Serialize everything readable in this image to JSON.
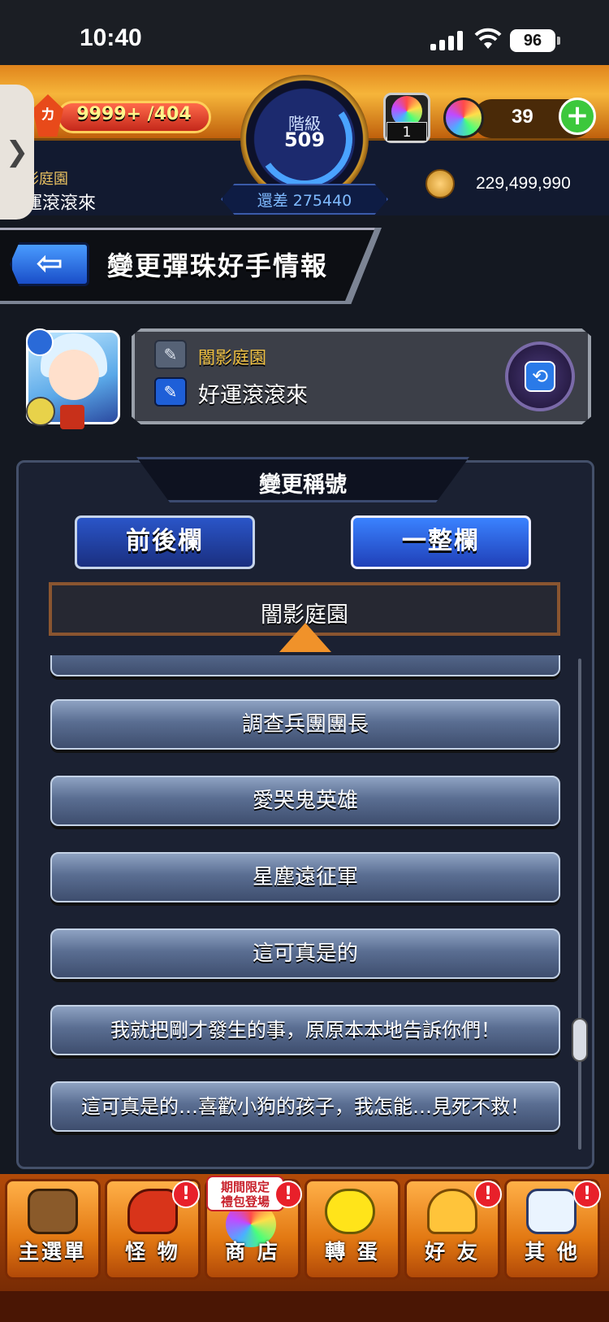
{
  "status_bar": {
    "time": "10:40",
    "battery": "96"
  },
  "header": {
    "stamina_icon": "カ",
    "stamina": "9999+ /404",
    "rank_label": "階級",
    "rank": "509",
    "remain": "還差 275440",
    "guild_line1": "影庭園",
    "guild_line2": "運滾滾來",
    "orb_stock_count": "1",
    "orb_count": "39",
    "gold": "229,499,990",
    "side_tab": "❯"
  },
  "title_bar": {
    "back_label": "⇦",
    "title": "變更彈珠好手情報"
  },
  "profile": {
    "guild_title": "闇影庭園",
    "nickname": "好運滾滾來",
    "pen_icon": "✎",
    "swap_icon": "⟲"
  },
  "panel": {
    "title": "變更稱號",
    "mode_left": "前後欄",
    "mode_right": "一整欄",
    "preview": "闇影庭園",
    "titles": [
      "調查兵團團長",
      "愛哭鬼英雄",
      "星塵遠征軍",
      "這可真是的",
      "我就把剛才發生的事，原原本本地告訴你們！",
      "這可真是的…喜歡小狗的孩子，我怎能…見死不救！"
    ]
  },
  "nav": {
    "items": [
      "主選單",
      "怪 物",
      "商 店",
      "轉 蛋",
      "好 友",
      "其 他"
    ],
    "promo": "期間限定\n禮包登場",
    "alert": "!"
  },
  "colors": {
    "accent_blue": "#2a55c8",
    "orange": "#e27812",
    "alert_red": "#e8202a",
    "guild_gold": "#f0c040"
  }
}
